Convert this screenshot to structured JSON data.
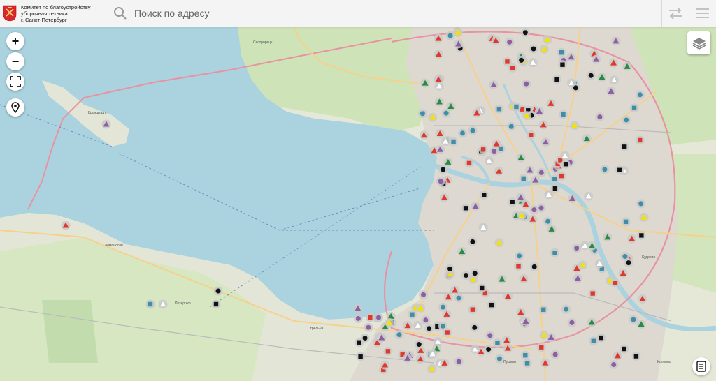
{
  "header": {
    "org_line1": "Комитет по благоустройству",
    "org_line2": "уборочная техника",
    "org_line3": "г. Санкт-Петербург",
    "search_placeholder": "Поиск по адресу"
  },
  "controls": {
    "zoom_in": "+",
    "zoom_out": "−"
  },
  "map_labels": {
    "kronshtadt": "Кронштадт",
    "lomonosov": "Ломоносов",
    "sestroretsk": "Сестрорецк",
    "strelna": "Стрельна",
    "petergof": "Петергоф",
    "kudrovo": "Кудрово",
    "pushkin": "Пушкин",
    "kolpino": "Колпино"
  },
  "colors": {
    "water": "#aad3df",
    "land": "#e8e6df",
    "city": "#dcd8d0",
    "park": "#c8e6b8",
    "forest": "#b8d9a6",
    "road_major": "#e892a2",
    "road_minor": "#f7d08a",
    "marker_blue": "#3f8ea8",
    "marker_red": "#e0392b",
    "marker_purple": "#8e5ea2",
    "marker_green": "#2a8a3e",
    "marker_yellow": "#f2e300",
    "marker_black": "#111111",
    "marker_halo": "#c9c9c9"
  },
  "icons": {
    "logo": "spb-coat-of-arms-icon",
    "search": "search-icon",
    "swap": "swap-arrows-icon",
    "menu": "hamburger-menu-icon",
    "fullscreen": "fullscreen-icon",
    "locate": "location-pin-icon",
    "layers": "layers-icon",
    "list": "list-icon"
  }
}
